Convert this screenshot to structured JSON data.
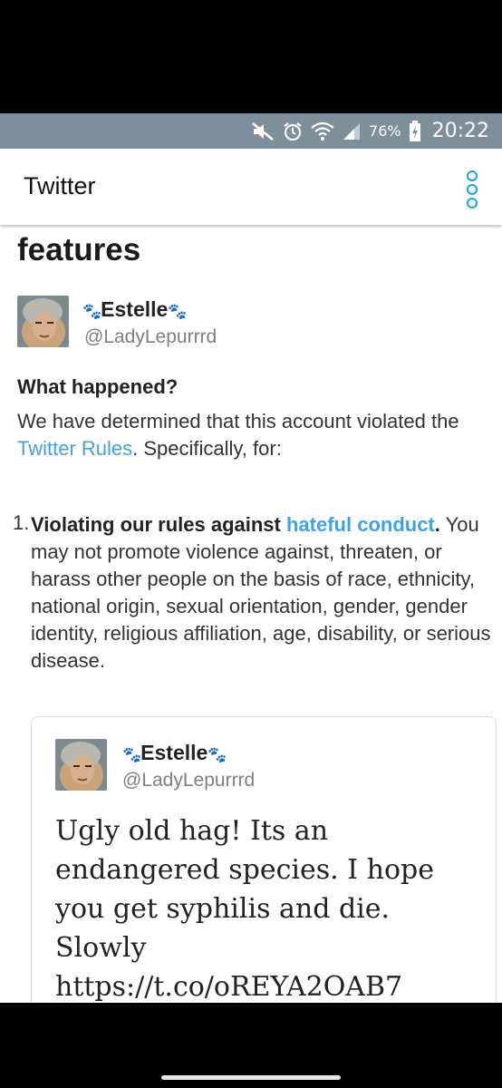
{
  "status_bar": {
    "battery_percent": "76%",
    "time": "20:22",
    "icons": [
      "mute-icon",
      "alarm-icon",
      "wifi-icon",
      "signal-icon",
      "battery-charging-icon"
    ]
  },
  "app_bar": {
    "title": "Twitter",
    "menu_icon": "overflow-menu-icon",
    "accent_color": "#1da1f2"
  },
  "page": {
    "heading": "features",
    "account": {
      "display_name": "Estelle",
      "paw_decoration": "🐾",
      "handle": "@LadyLepurrrd"
    },
    "what_happened": {
      "title": "What happened?",
      "text_before": "We have determined that this account violated the ",
      "link": "Twitter Rules",
      "text_after": ". Specifically, for:"
    },
    "violations": [
      {
        "number": "1.",
        "title_prefix": "Violating our rules against ",
        "title_link": "hateful conduct",
        "title_suffix": ".",
        "description": "You may not promote violence against, threaten, or harass other people on the basis of race, ethnicity, national origin, sexual orientation, gender, gender identity, religious affiliation, age, disability, or serious disease."
      }
    ],
    "tweet": {
      "display_name": "Estelle",
      "handle": "@LadyLepurrrd",
      "text": "Ugly old hag! Its an endangered species. I hope you get syphilis and die. Slowly https://t.co/oREYA2OAB7"
    },
    "link_color": "#3ea2e8"
  }
}
